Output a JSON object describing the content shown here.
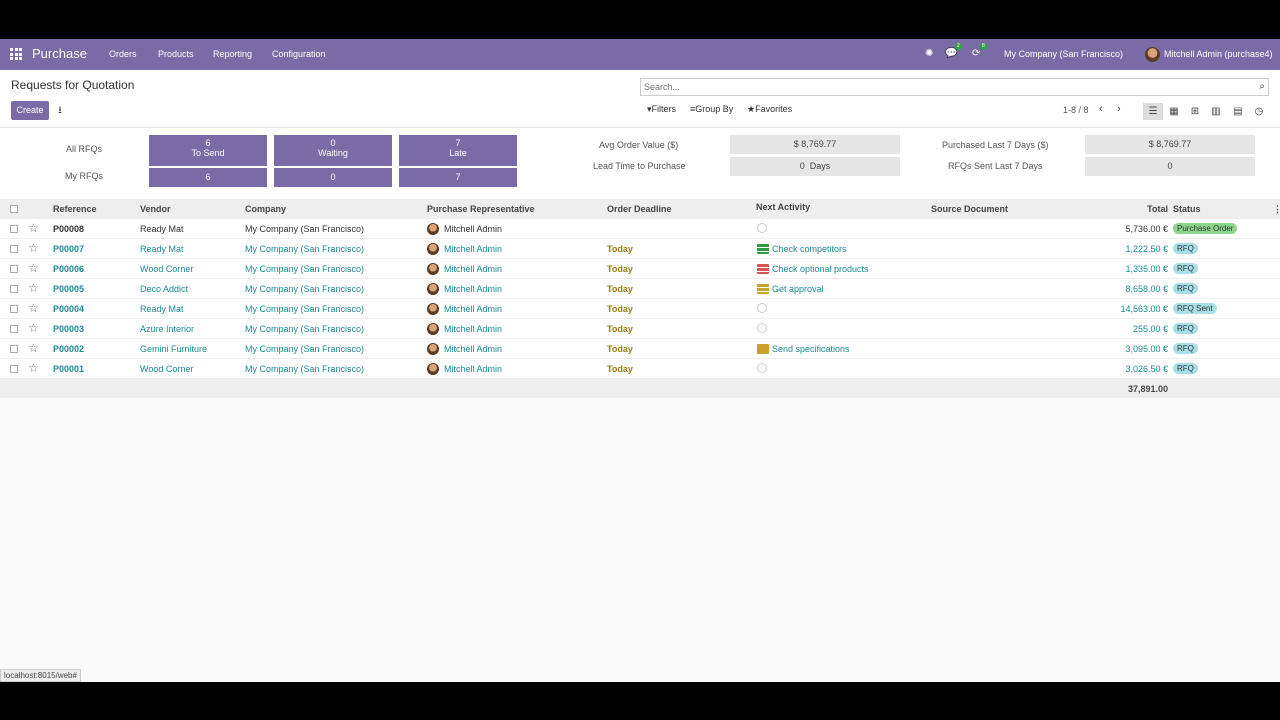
{
  "navbar": {
    "brand": "Purchase",
    "menu": [
      "Orders",
      "Products",
      "Reporting",
      "Configuration"
    ],
    "badges": {
      "messages": "2",
      "activities": "8"
    },
    "company": "My Company (San Francisco)",
    "user": "Mitchell Admin (purchase4)"
  },
  "control_panel": {
    "title": "Requests for Quotation",
    "create_label": "Create",
    "search_placeholder": "Search...",
    "filters_label": "Filters",
    "groupby_label": "Group By",
    "favorites_label": "Favorites",
    "pager": "1-8 / 8"
  },
  "dashboard": {
    "all_rfqs": "All RFQs",
    "my_rfqs": "My RFQs",
    "tiles": [
      {
        "value": "6",
        "label": "To Send",
        "mine": "6"
      },
      {
        "value": "0",
        "label": "Waiting",
        "mine": "0"
      },
      {
        "value": "7",
        "label": "Late",
        "mine": "7"
      }
    ],
    "stats": {
      "avg_order_label": "Avg Order Value ($)",
      "avg_order_value": "$ 8,769.77",
      "lead_time_label": "Lead Time to Purchase",
      "lead_time_value": "0  Days",
      "purchased_label": "Purchased Last 7 Days ($)",
      "purchased_value": "$ 8,769.77",
      "rfq_sent_label": "RFQs Sent Last 7 Days",
      "rfq_sent_value": "0"
    }
  },
  "table": {
    "headers": {
      "reference": "Reference",
      "vendor": "Vendor",
      "company": "Company",
      "rep": "Purchase Representative",
      "deadline": "Order Deadline",
      "activity": "Next Activity",
      "source": "Source Document",
      "total": "Total",
      "status": "Status"
    },
    "rows": [
      {
        "ref": "P00008",
        "vendor": "Ready Mat",
        "company": "My Company (San Francisco)",
        "rep": "Mitchell Admin",
        "deadline": "",
        "activity": "",
        "activity_icon": "none",
        "total": "5,736.00 €",
        "status": "Purchase Order",
        "status_kind": "po"
      },
      {
        "ref": "P00007",
        "vendor": "Ready Mat",
        "company": "My Company (San Francisco)",
        "rep": "Mitchell Admin",
        "deadline": "Today",
        "activity": "Check competitors",
        "activity_icon": "todo-icon",
        "total": "1,222.50 €",
        "status": "RFQ",
        "status_kind": "rfq"
      },
      {
        "ref": "P00006",
        "vendor": "Wood Corner",
        "company": "My Company (San Francisco)",
        "rep": "Mitchell Admin",
        "deadline": "Today",
        "activity": "Check optional products",
        "activity_icon": "todo-red-icon",
        "total": "1,335.00 €",
        "status": "RFQ",
        "status_kind": "rfq"
      },
      {
        "ref": "P00005",
        "vendor": "Deco Addict",
        "company": "My Company (San Francisco)",
        "rep": "Mitchell Admin",
        "deadline": "Today",
        "activity": "Get approval",
        "activity_icon": "approval-icon",
        "total": "8,658.00 €",
        "status": "RFQ",
        "status_kind": "rfq"
      },
      {
        "ref": "P00004",
        "vendor": "Ready Mat",
        "company": "My Company (San Francisco)",
        "rep": "Mitchell Admin",
        "deadline": "Today",
        "activity": "",
        "activity_icon": "none",
        "total": "14,563.00 €",
        "status": "RFQ Sent",
        "status_kind": "sent"
      },
      {
        "ref": "P00003",
        "vendor": "Azure Interior",
        "company": "My Company (San Francisco)",
        "rep": "Mitchell Admin",
        "deadline": "Today",
        "activity": "",
        "activity_icon": "none",
        "total": "255.00 €",
        "status": "RFQ",
        "status_kind": "rfq"
      },
      {
        "ref": "P00002",
        "vendor": "Gemini Furniture",
        "company": "My Company (San Francisco)",
        "rep": "Mitchell Admin",
        "deadline": "Today",
        "activity": "Send specifications",
        "activity_icon": "email-icon",
        "total": "3,095.00 €",
        "status": "RFQ",
        "status_kind": "rfq"
      },
      {
        "ref": "P00001",
        "vendor": "Wood Corner",
        "company": "My Company (San Francisco)",
        "rep": "Mitchell Admin",
        "deadline": "Today",
        "activity": "",
        "activity_icon": "none",
        "total": "3,026.50 €",
        "status": "RFQ",
        "status_kind": "rfq"
      }
    ],
    "grand_total": "37,891.00"
  },
  "statusbar": "localhost:8015/web#",
  "colors": {
    "brand": "#7a6aa6",
    "link": "#1c8a95",
    "today": "#9a7b11"
  }
}
